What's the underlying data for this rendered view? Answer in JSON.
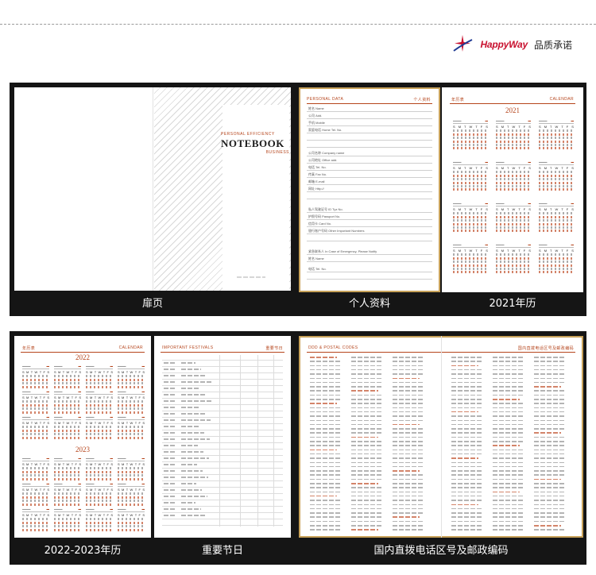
{
  "brand": {
    "name": "HappyWay",
    "slogan": "品质承诺",
    "logo_icon": "star-swoosh-logo",
    "accent_color": "#c8102e"
  },
  "captions": {
    "title_page": "扉页",
    "personal_data": "个人资料",
    "calendar_2021": "2021年历",
    "calendar_2022_2023": "2022-2023年历",
    "festivals": "重要节日",
    "area_codes": "国内直拨电话区号及邮政编码"
  },
  "title_page": {
    "line1": "PERSONAL EFFICIENCY",
    "line2": "NOTEBOOK",
    "line3": "BUSINESS"
  },
  "personal_data_page": {
    "header_left": "PERSONAL DATA",
    "header_right": "个人资料",
    "fields": [
      "姓名 Name",
      "公司 Add.",
      "手机 Mobile",
      "家庭电话 Home Tel. No.",
      "公司名称 Company name",
      "公司地址 Office add.",
      "电话 Tel. No.",
      "传真 Fax No.",
      "邮箱 E-mail",
      "网址 Http://",
      "私人驾驶证号 ID Tyz No.",
      "护照号码 Passport No.",
      "信用卡 Card No.",
      "银行账户号码 Other Important Numbers",
      "紧急联系人 In Case of Emergency, Please Notify",
      "姓名 Name",
      "电话 Tel. No."
    ]
  },
  "calendar_2021_page": {
    "header_left": "年历表",
    "header_right": "CALENDAR",
    "year": "2021"
  },
  "calendar_2223_page": {
    "header_left": "年历表",
    "header_right": "CALENDAR",
    "year_top": "2022",
    "year_bottom": "2023"
  },
  "festivals_page": {
    "header_left": "IMPORTANT FESTIVALS",
    "header_right": "重要节日"
  },
  "area_codes_page": {
    "header_left": "DDD & POSTAL CODES",
    "header_right": "国内直拨电话区号及邮政编码"
  },
  "colors": {
    "panel_dark": "#151515",
    "gold_frame": "#c8a25a",
    "accent_orange": "#b5441b"
  }
}
